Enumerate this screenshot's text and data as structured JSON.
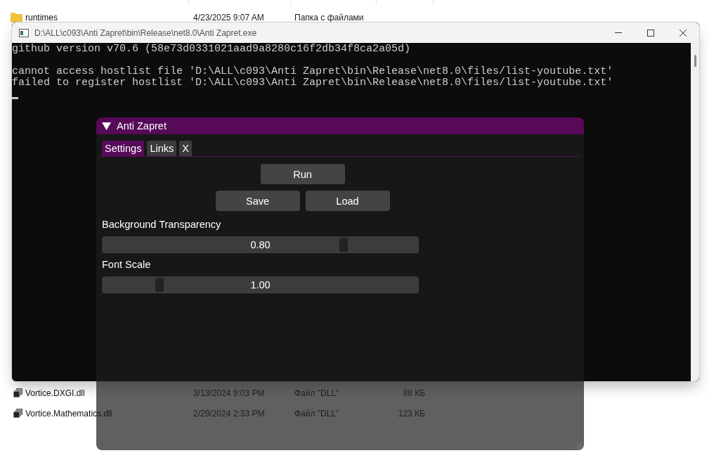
{
  "explorer": {
    "rows_top": [
      {
        "kind": "folder",
        "name": "runtimes",
        "date": "4/23/2025 9:07 AM",
        "type": "Папка с файлами"
      }
    ],
    "rows_bottom": [
      {
        "kind": "dll",
        "name": "Vortice.DXGI.dll",
        "date": "3/13/2024 9:03 PM",
        "type": "Файл \"DLL\"",
        "size": "88 КБ"
      },
      {
        "kind": "dll",
        "name": "Vortice.Mathematics.dll",
        "date": "2/29/2024 2:33 PM",
        "type": "Файл \"DLL\"",
        "size": "123 КБ"
      }
    ]
  },
  "console": {
    "title": "D:\\ALL\\c093\\Anti Zapret\\bin\\Release\\net8.0\\Anti Zapret.exe",
    "blocks": [
      [
        "github version v70.6 (58e73d0331021aad9a8280c16f2db34f8ca2a05d)"
      ],
      [
        "cannot access hostlist file 'D:\\ALL\\c093\\Anti Zapret\\bin\\Release\\net8.0\\files/list-youtube.txt'",
        "failed to register hostlist 'D:\\ALL\\c093\\Anti Zapret\\bin\\Release\\net8.0\\files/list-youtube.txt'"
      ]
    ]
  },
  "panel": {
    "title": "Anti Zapret",
    "expanded": true,
    "tabs": [
      {
        "label": "Settings",
        "selected": true
      },
      {
        "label": "Links",
        "selected": false
      },
      {
        "label": "X",
        "selected": false
      }
    ],
    "button_rows": [
      [
        "Run"
      ],
      [
        "Save",
        "Load"
      ]
    ],
    "sliders": [
      {
        "label": "Background Transparency",
        "value": "0.80",
        "level": 0.77
      },
      {
        "label": "Font Scale",
        "value": "1.00",
        "level": 0.17
      }
    ]
  }
}
